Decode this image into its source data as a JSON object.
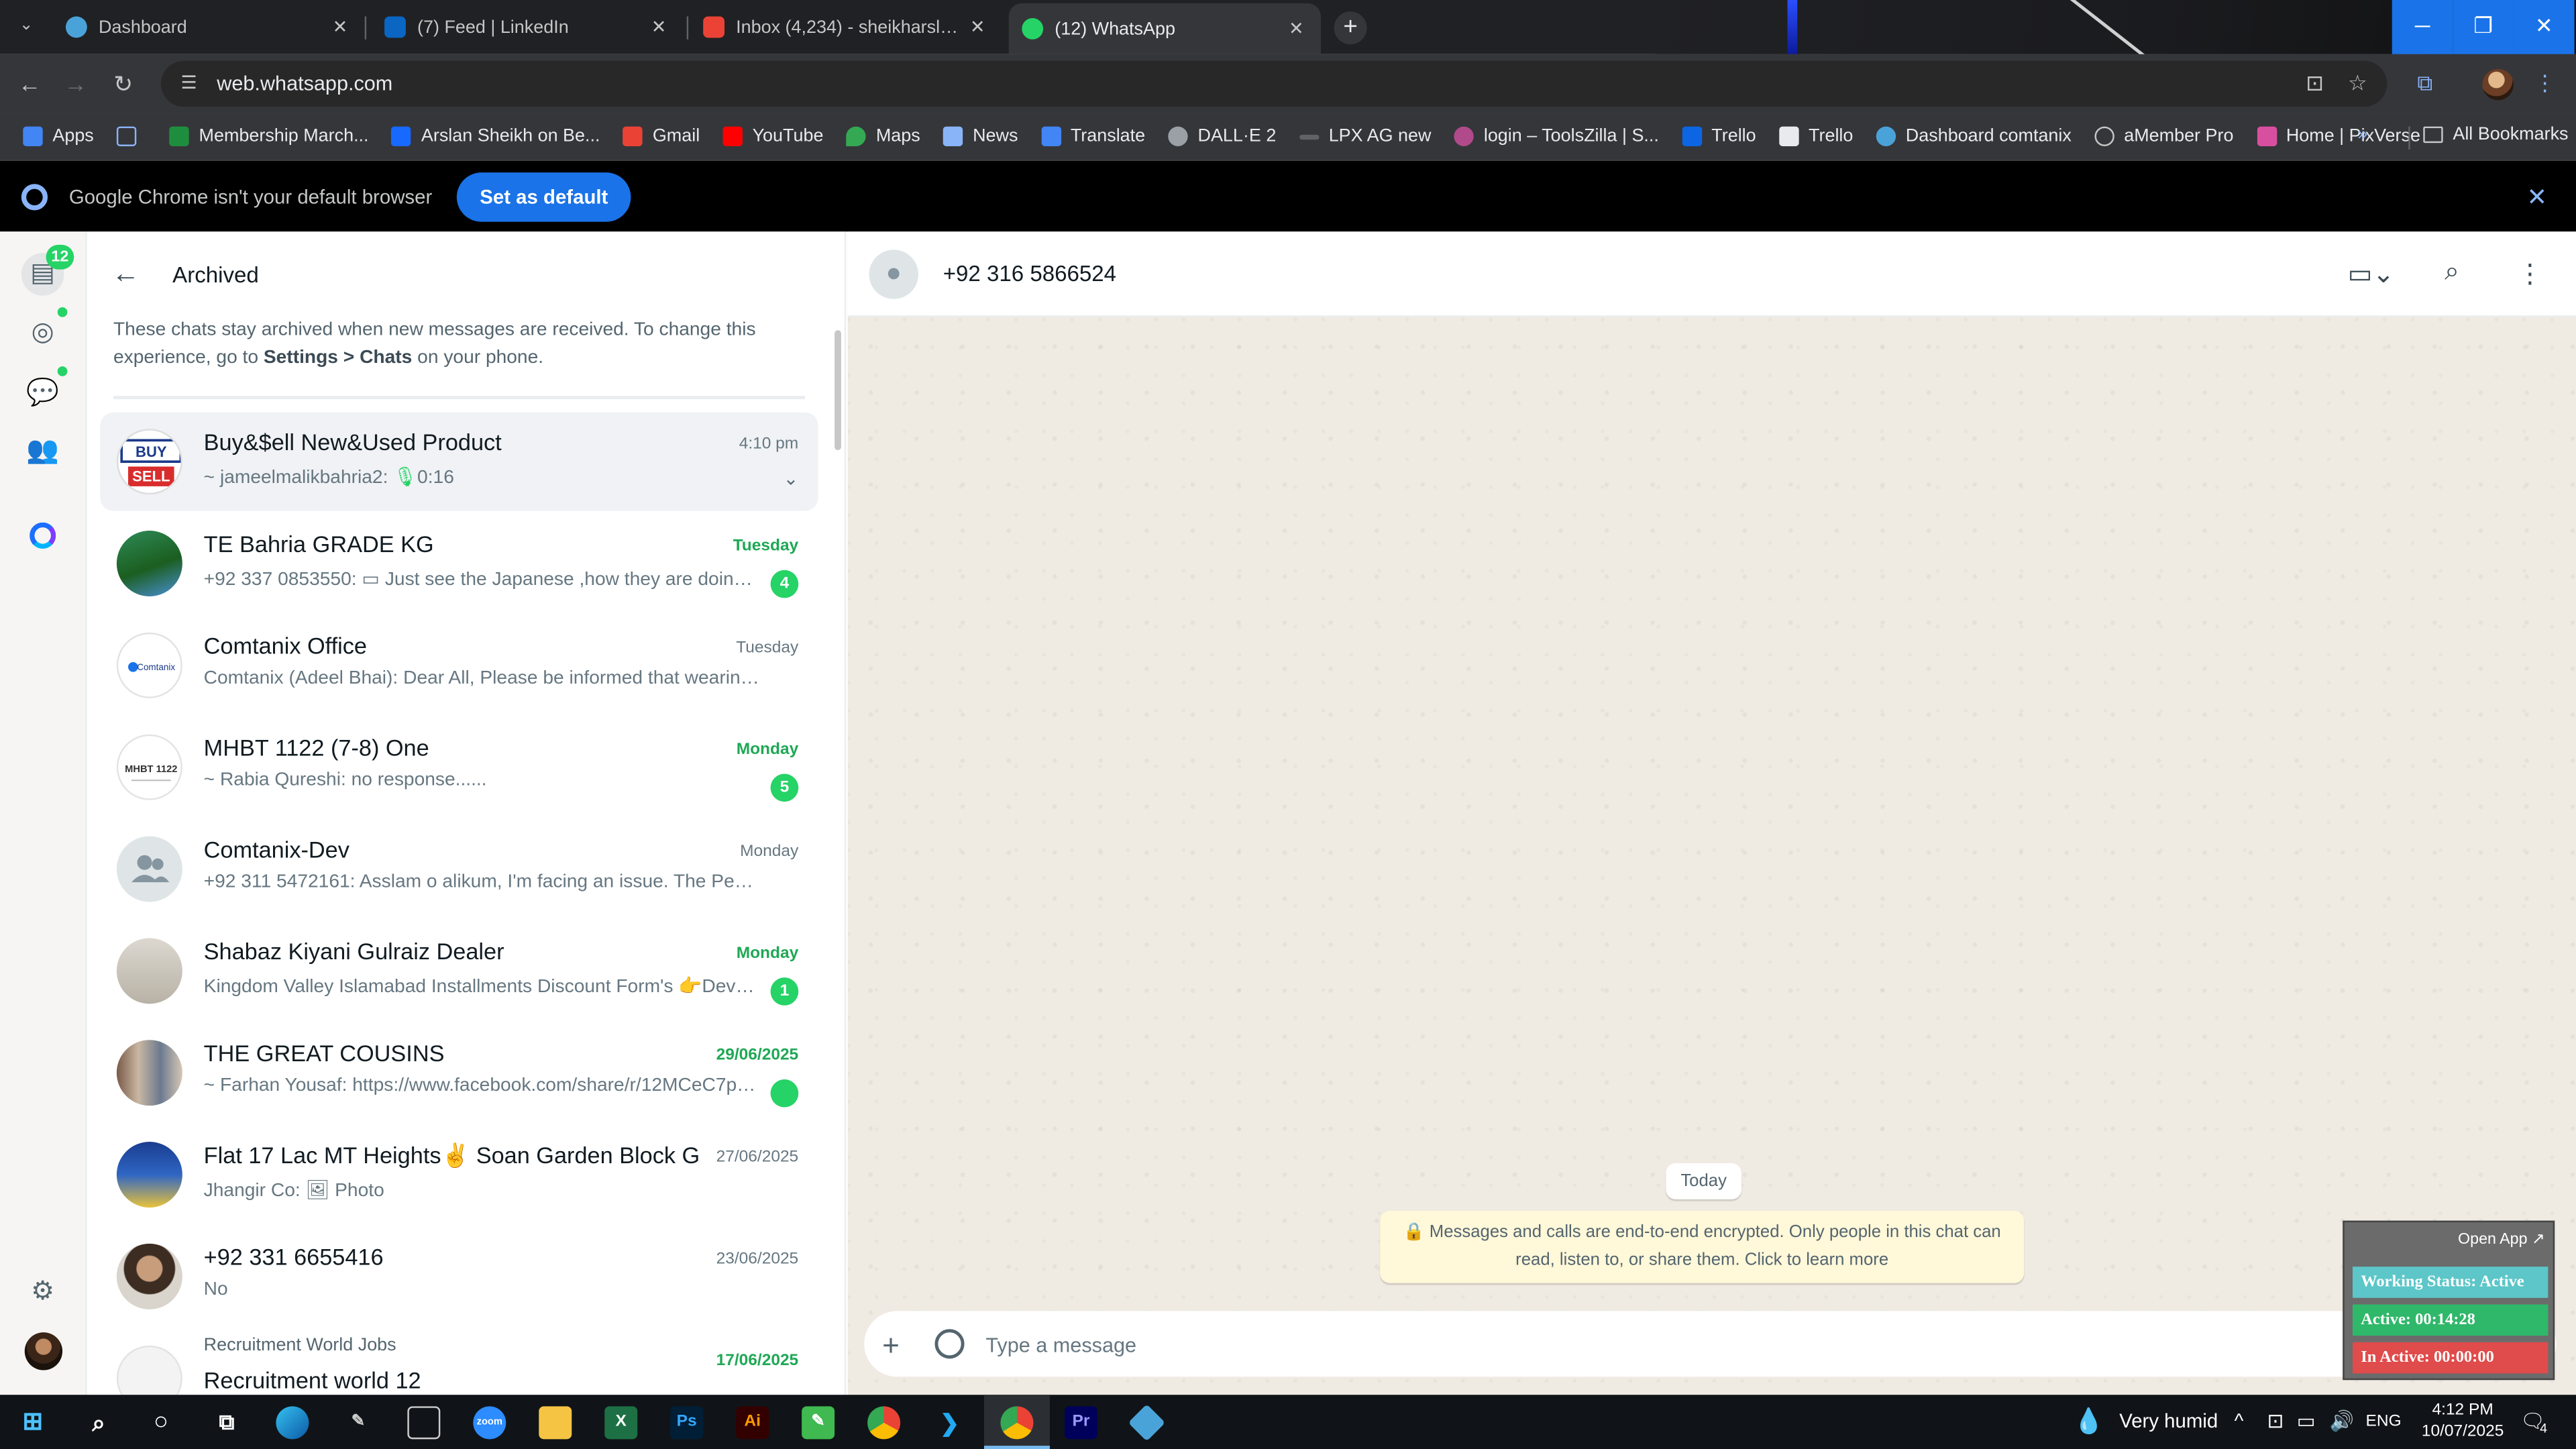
{
  "tabs": [
    {
      "title": "Dashboard",
      "favicon_color": "#4aa3d8"
    },
    {
      "title": "(7) Feed | LinkedIn",
      "favicon_color": "#0a66c2"
    },
    {
      "title": "Inbox (4,234) - sheikharsl01@g",
      "favicon_color": "#ea4335"
    },
    {
      "title": "(12) WhatsApp",
      "favicon_color": "#25d366"
    }
  ],
  "address": {
    "url": "web.whatsapp.com"
  },
  "bookmarks": [
    {
      "label": "Apps",
      "color": "#4285f4"
    },
    {
      "label": "",
      "color": "#8ab4f8"
    },
    {
      "label": "Membership March...",
      "color": "#1e8e3e"
    },
    {
      "label": "Arslan Sheikh on Be...",
      "color": "#1769ff"
    },
    {
      "label": "Gmail",
      "color": "#ea4335"
    },
    {
      "label": "YouTube",
      "color": "#ff0000"
    },
    {
      "label": "Maps",
      "color": "#34a853"
    },
    {
      "label": "News",
      "color": "#8ab4f8"
    },
    {
      "label": "Translate",
      "color": "#4285f4"
    },
    {
      "label": "DALL·E 2",
      "color": "#9aa0a6"
    },
    {
      "label": "LPX AG new",
      "color": "#5f6368"
    },
    {
      "label": "login – ToolsZilla | S...",
      "color": "#b04a8a"
    },
    {
      "label": "Trello",
      "color": "#0c66e4"
    },
    {
      "label": "Trello",
      "color": "#e8eaed"
    },
    {
      "label": "Dashboard comtanix",
      "color": "#4aa3d8"
    },
    {
      "label": "aMember Pro",
      "color": "#c4c7c5"
    },
    {
      "label": "Home | PixVerse",
      "color": "#d94fa0"
    }
  ],
  "all_bookmarks": "All Bookmarks",
  "banner": {
    "text": "Google Chrome isn't your default browser",
    "button": "Set as default"
  },
  "rail": {
    "badge": "12"
  },
  "archived": {
    "title": "Archived",
    "info_pre": "These chats stay archived when new messages are received. To change this experience, go to ",
    "info_settings": "Settings > Chats",
    "info_post": " on your phone."
  },
  "chats": [
    {
      "name": "Buy&$ell New&Used Product",
      "time": "4:10 pm",
      "sender": "~ jameelmalikbahria2: ",
      "message": "0:16",
      "unread": "",
      "time_unread": false
    },
    {
      "name": "TE Bahria GRADE KG",
      "time": "Tuesday",
      "sender": "+92 337 0853550: ",
      "message": "Just see  the Japanese ,how they are doing ...",
      "unread": "4",
      "time_unread": true
    },
    {
      "name": "Comtanix Office",
      "time": "Tuesday",
      "sender": "Comtanix (Adeel Bhai): ",
      "message": "Dear All,  Please be informed that wearing yo...",
      "unread": "",
      "time_unread": false
    },
    {
      "name": "MHBT 1122 (7-8) One",
      "time": "Monday",
      "sender": "~ Rabia Qureshi: ",
      "message": "no response......",
      "unread": "5",
      "time_unread": true
    },
    {
      "name": "Comtanix-Dev",
      "time": "Monday",
      "sender": "+92 311 5472161: ",
      "message": "Asslam o alikum, I'm facing an issue. The Peerwad...",
      "unread": "",
      "time_unread": false
    },
    {
      "name": "Shabaz Kiyani Gulraiz Dealer",
      "time": "Monday",
      "sender": "",
      "message": "Kingdom Valley Islamabad Installments Discount Form's 👉Devel...",
      "unread": "1",
      "time_unread": true
    },
    {
      "name": "THE GREAT COUSINS",
      "time": "29/06/2025",
      "sender": "~ Farhan Yousaf: ",
      "message": "https://www.facebook.com/share/r/12MCeC7pY...",
      "unread": " ",
      "time_unread": true
    },
    {
      "name": "Flat 17 Lac MT Heights✌️  Soan Garden Block G",
      "time": "27/06/2025",
      "sender": "Jhangir Co: ",
      "message": "Photo",
      "unread": "",
      "time_unread": false
    },
    {
      "name": "+92 331 6655416",
      "time": "23/06/2025",
      "sender": "",
      "message": "No",
      "unread": "",
      "time_unread": false
    },
    {
      "name": "Recruitment world 12",
      "time": "17/06/2025",
      "sender": "Recruitment World Jobs",
      "message": "",
      "unread": "",
      "time_unread": true
    }
  ],
  "conversation": {
    "contact": "+92 316 5866524",
    "today": "Today",
    "e2e": "Messages and calls are end-to-end encrypted. Only people in this chat can read, listen to, or share them. Click to learn more",
    "placeholder": "Type a message"
  },
  "widget": {
    "open": "Open App ↗",
    "status": "Working Status: Active",
    "active": "Active: 00:14:28",
    "inactive": "In Active: 00:00:00"
  },
  "taskbar": {
    "weather": "Very humid",
    "lang": "ENG",
    "time": "4:12 PM",
    "date": "10/07/2025",
    "notifications": "4"
  }
}
